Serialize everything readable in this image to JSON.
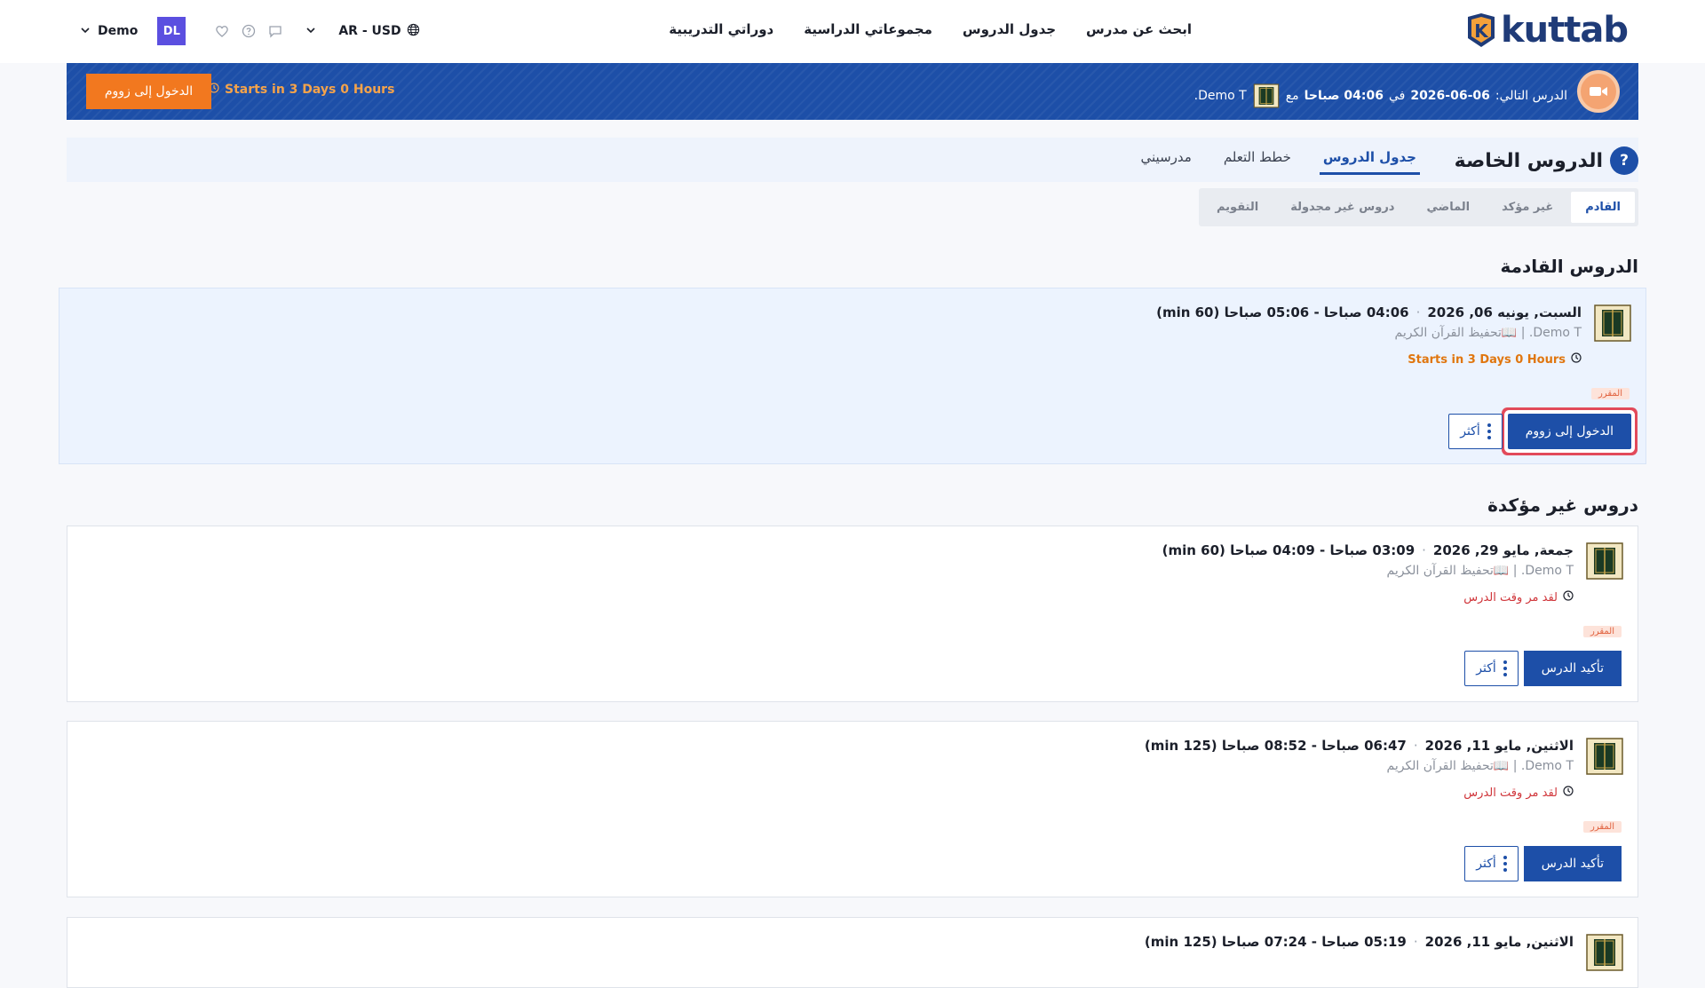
{
  "nav": {
    "logo_text": "kuttab",
    "logo_letter": "K",
    "links": [
      "ابحث عن مدرس",
      "جدول الدروس",
      "مجموعاتي الدراسية",
      "دوراتي التدريبية"
    ],
    "language": "AR - USD",
    "user_initials": "DL",
    "user_name": "Demo"
  },
  "banner": {
    "label": "الدرس التالي:",
    "date": "2026-06-06",
    "at": "في",
    "time": "04:06 صباحا",
    "with": "مع",
    "teacher": "Demo T.",
    "starts": "Starts in 3 Days 0 Hours",
    "join_label": "الدخول إلى زووم"
  },
  "header": {
    "title": "الدروس الخاصة",
    "help": "?",
    "tabs": [
      {
        "label": "جدول الدروس",
        "active": true
      },
      {
        "label": "خطط التعلم",
        "active": false
      },
      {
        "label": "مدرسيني",
        "active": false
      }
    ],
    "subtabs": [
      {
        "label": "القادم",
        "active": true
      },
      {
        "label": "غير مؤكد",
        "active": false
      },
      {
        "label": "الماضي",
        "active": false
      },
      {
        "label": "دروس غير مجدولة",
        "active": false
      },
      {
        "label": "التقويم",
        "active": false
      }
    ]
  },
  "sections": {
    "upcoming_title": "الدروس القادمة",
    "unconfirmed_title": "دروس غير مؤكدة"
  },
  "upcoming": [
    {
      "date": "السبت, يونيه 06, 2026",
      "time": "04:06 صباحا - 05:06 صباحا (60 min)",
      "teacher": "Demo T. | 📖تحفيظ القرآن الكريم",
      "status": "Starts in 3 Days 0 Hours",
      "badge": "المقرر",
      "primary": "الدخول إلى زووم",
      "more": "أكثر"
    }
  ],
  "unconfirmed": [
    {
      "date": "جمعة, مايو 29, 2026",
      "time": "03:09 صباحا - 04:09 صباحا (60 min)",
      "teacher": "Demo T. | 📖تحفيظ القرآن الكريم",
      "status": "لقد مر وقت الدرس",
      "badge": "المقرر",
      "primary": "تأكيد الدرس",
      "more": "أكثر"
    },
    {
      "date": "الاثنين, مايو 11, 2026",
      "time": "06:47 صباحا - 08:52 صباحا (125 min)",
      "teacher": "Demo T. | 📖تحفيظ القرآن الكريم",
      "status": "لقد مر وقت الدرس",
      "badge": "المقرر",
      "primary": "تأكيد الدرس",
      "more": "أكثر"
    },
    {
      "date": "الاثنين, مايو 11, 2026",
      "time": "05:19 صباحا - 07:24 صباحا (125 min)",
      "teacher": "",
      "status": "",
      "badge": "",
      "primary": "",
      "more": ""
    }
  ],
  "colors": {
    "brand_blue": "#1d4fa8",
    "accent_orange": "#f2781f",
    "alert_red": "#d0353a"
  }
}
